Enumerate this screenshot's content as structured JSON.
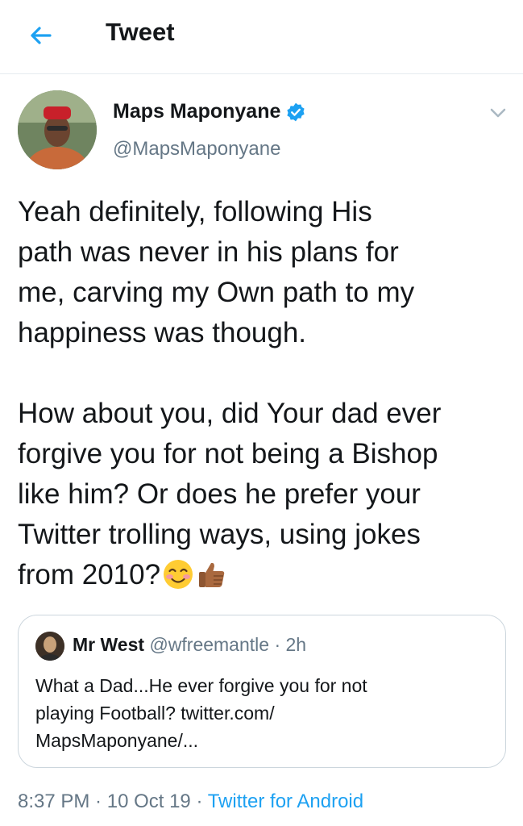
{
  "header": {
    "title": "Tweet"
  },
  "tweet": {
    "author": {
      "name": "Maps Maponyane",
      "handle": "@MapsMaponyane"
    },
    "text": "Yeah definitely, following His\npath was never in his plans for\nme, carving my Own path to my\nhappiness was though.\n\nHow about you, did Your dad ever\nforgive you for not being a Bishop\nlike him? Or does he prefer your\nTwitter trolling ways, using jokes\nfrom 2010?",
    "emojis": [
      "smiling-face-with-smiling-eyes",
      "thumbs-up-medium-dark-skin"
    ],
    "time": "8:37 PM",
    "date": "10 Oct 19",
    "source": "Twitter for Android",
    "separator": " · "
  },
  "quote": {
    "name": "Mr West",
    "handle": "@wfreemantle",
    "time": "2h",
    "separator": " · ",
    "text": "What a Dad...He ever forgive you for not\nplaying Football? twitter.com/\nMapsMaponyane/..."
  },
  "colors": {
    "accent": "#1da1f2",
    "muted": "#657786",
    "text": "#14171a",
    "border": "#ccd6dd"
  },
  "icons": [
    "back-arrow-icon",
    "verified-badge-icon",
    "chevron-down-icon"
  ]
}
